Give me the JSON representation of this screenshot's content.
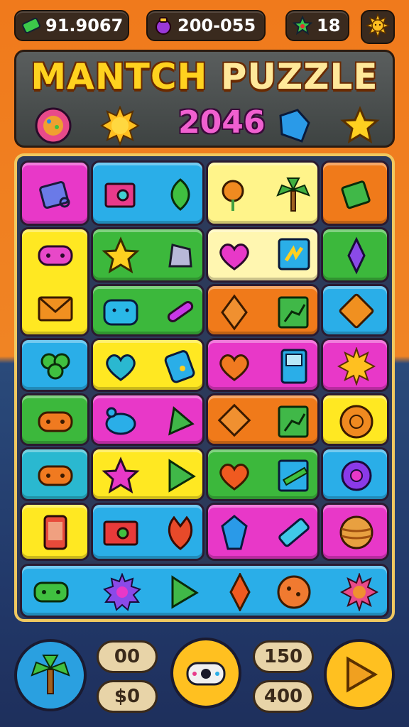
{
  "hud": {
    "cash": "91.9067",
    "potion": "200-055",
    "stars": "18"
  },
  "banner": {
    "title_part1": "MANTCH ",
    "title_part2": "PUZZLE",
    "subtitle": "2046"
  },
  "board": {
    "tiles": [
      {
        "color": "#e838c8",
        "icon": "wallet-icon"
      },
      {
        "color": "#2aaee8",
        "icon": "camera-icon"
      },
      {
        "color": "#fff48a",
        "icon": "flower-icon"
      },
      {
        "color": "#f07a1a",
        "icon": "gift-icon"
      }
    ]
  },
  "bottom": {
    "counter_top_left": "00",
    "counter_bottom_left": "$0",
    "counter_top_right": "150",
    "counter_bottom_right": "400"
  },
  "colors": {
    "magenta": "#e838c8",
    "blue": "#2aaee8",
    "yellow": "#ffe822",
    "orange": "#f07a1a",
    "green": "#3cb83c",
    "cream": "#fff6b0",
    "board_border": "#f0c860"
  }
}
